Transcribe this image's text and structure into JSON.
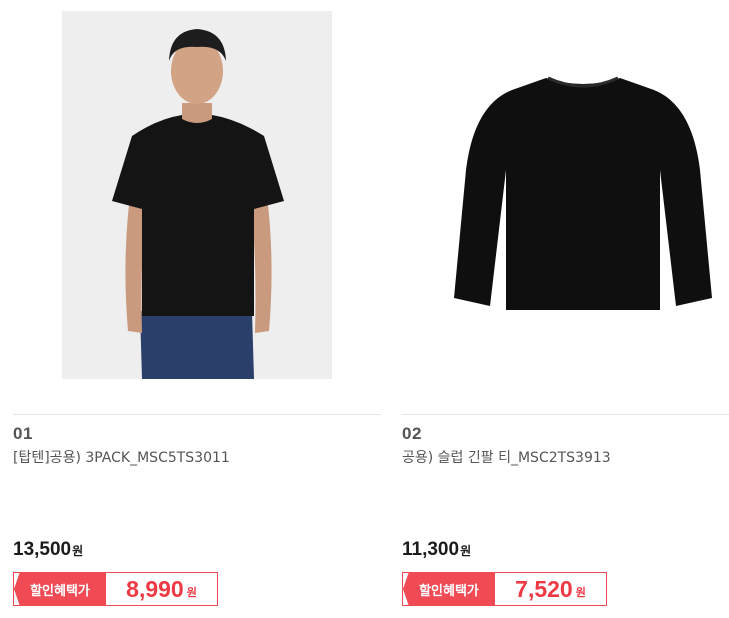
{
  "products": [
    {
      "rank": "01",
      "name": "[탑텐]공용) 3PACK_MSC5TS3011",
      "price": "13,500",
      "currency": "원",
      "sale_label": "할인혜택가",
      "sale_price": "8,990",
      "image": "model-wearing-black-tshirt"
    },
    {
      "rank": "02",
      "name": "공용) 슬럽 긴팔 티_MSC2TS3913",
      "price": "11,300",
      "currency": "원",
      "sale_label": "할인혜택가",
      "sale_price": "7,520",
      "image": "black-long-sleeve-tee"
    }
  ],
  "colors": {
    "accent": "#f04b55",
    "sale_price": "#ee3a44"
  }
}
